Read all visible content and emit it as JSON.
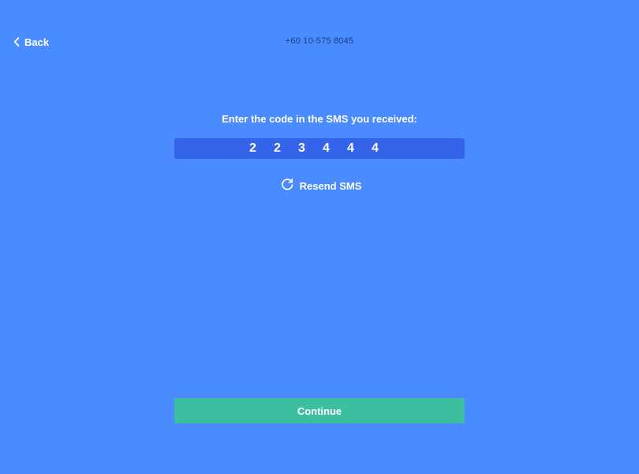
{
  "header": {
    "back_label": "Back",
    "phone_number": "+60 10-575 8045"
  },
  "verification": {
    "instruction": "Enter the code in the SMS you received:",
    "code_digits": [
      "2",
      "2",
      "3",
      "4",
      "4",
      "4"
    ],
    "resend_label": "Resend SMS"
  },
  "footer": {
    "continue_label": "Continue"
  },
  "icons": {
    "back": "chevron-left-icon",
    "resend": "refresh-icon"
  },
  "colors": {
    "background": "#4a8bff",
    "code_field": "#3564eb",
    "continue_button": "#3bbf9e",
    "phone_text": "#1f3f7a",
    "text": "#ffffff"
  }
}
